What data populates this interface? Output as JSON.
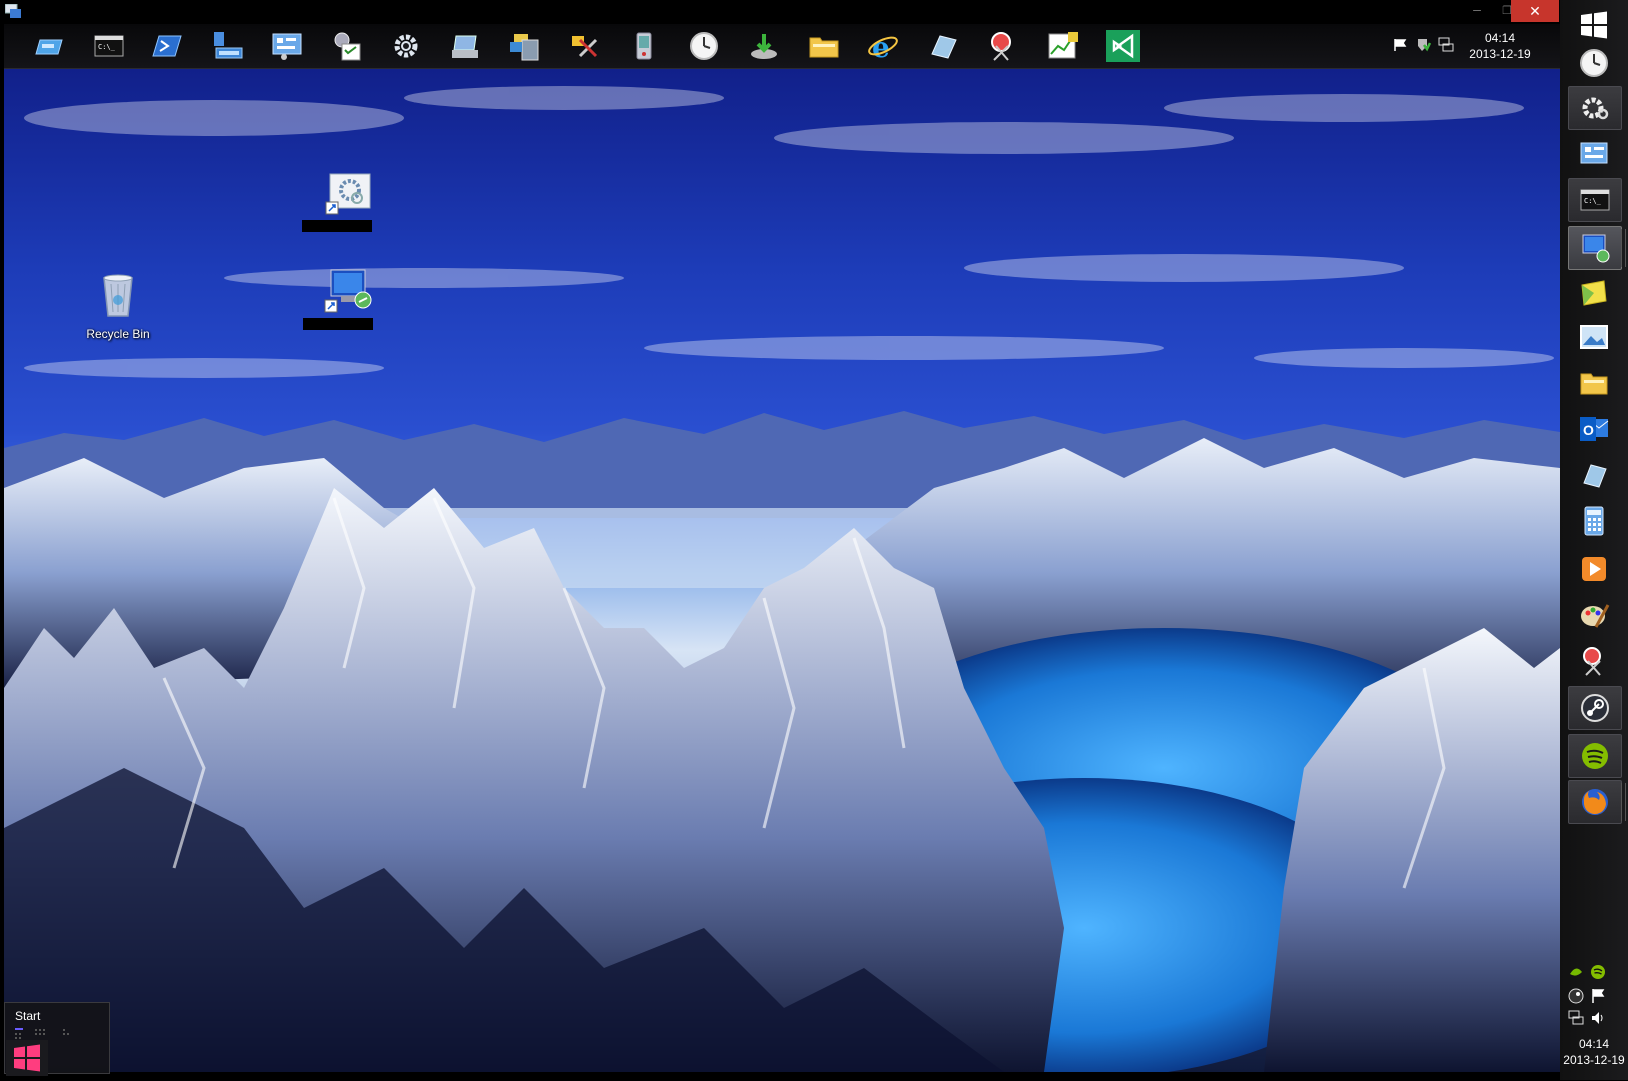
{
  "window": {
    "close_glyph": "✕",
    "minimize_glyph": "–",
    "maximize_glyph": "❐"
  },
  "top_toolbar": {
    "buttons": [
      {
        "icon": "cd-drive-icon"
      },
      {
        "icon": "command-prompt-icon"
      },
      {
        "icon": "powershell-icon"
      },
      {
        "icon": "network-adapter-icon"
      },
      {
        "icon": "control-panel-icon"
      },
      {
        "icon": "task-scheduler-icon"
      },
      {
        "icon": "gear-icon"
      },
      {
        "icon": "device-manager-icon"
      },
      {
        "icon": "computer-management-icon"
      },
      {
        "icon": "system-tools-icon"
      },
      {
        "icon": "phone-icon"
      },
      {
        "icon": "clock-icon"
      },
      {
        "icon": "install-icon"
      },
      {
        "icon": "folder-icon"
      },
      {
        "icon": "internet-explorer-icon"
      },
      {
        "icon": "eraser-icon"
      },
      {
        "icon": "snipping-tool-icon"
      },
      {
        "icon": "performance-icon"
      },
      {
        "icon": "visual-studio-icon"
      }
    ],
    "clock": {
      "time": "04:14",
      "date": "2013-12-19"
    }
  },
  "right_taskbar": {
    "buttons": [
      {
        "icon": "windows-start-icon"
      },
      {
        "icon": "clock-icon"
      },
      {
        "icon": "gear-icon"
      },
      {
        "icon": "control-panel-icon"
      },
      {
        "icon": "command-prompt-icon"
      },
      {
        "icon": "remote-desktop-icon"
      },
      {
        "icon": "sticky-notes-icon"
      },
      {
        "icon": "photo-viewer-icon"
      },
      {
        "icon": "folder-icon"
      },
      {
        "icon": "outlook-icon"
      },
      {
        "icon": "eraser-icon"
      },
      {
        "icon": "calculator-icon"
      },
      {
        "icon": "media-player-icon"
      },
      {
        "icon": "paint-icon"
      },
      {
        "icon": "snipping-tool-icon"
      },
      {
        "icon": "steam-icon"
      },
      {
        "icon": "spotify-icon"
      },
      {
        "icon": "firefox-icon"
      }
    ],
    "clock": {
      "time": "04:14",
      "date": "2013-12-19"
    }
  },
  "desktop": {
    "icons": [
      {
        "label": "Recycle Bin",
        "icon": "recycle-bin-icon"
      },
      {
        "label": "",
        "icon": "settings-shortcut-icon"
      },
      {
        "label": "",
        "icon": "remote-desktop-shortcut-icon"
      }
    ]
  },
  "start_panel": {
    "label": "Start"
  },
  "colors": {
    "accent": "#c7352c",
    "start_pink": "#ff3d7f",
    "desktop_sky": "#1d3cb8"
  }
}
